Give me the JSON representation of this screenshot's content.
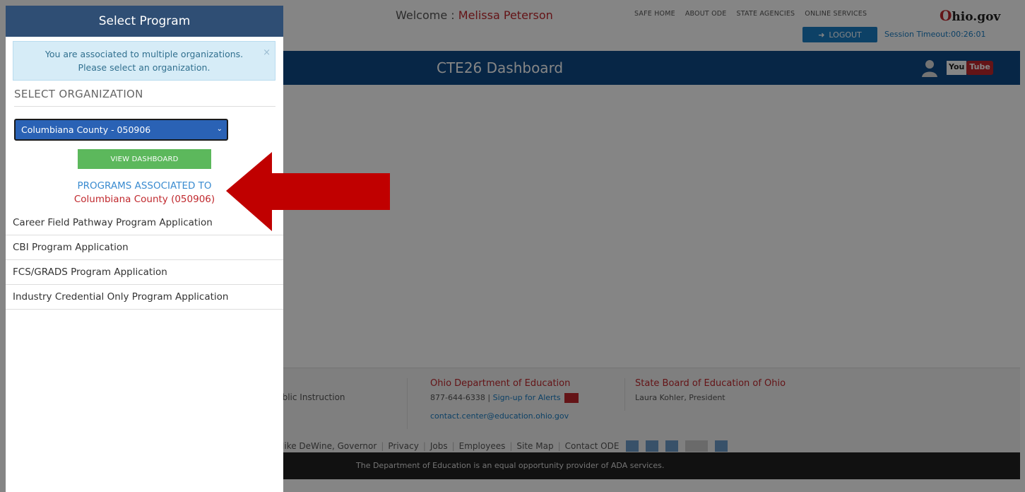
{
  "header": {
    "welcome_prefix": "Welcome :",
    "user_name": "Melissa Peterson",
    "links": [
      "SAFE HOME",
      "ABOUT ODE",
      "STATE AGENCIES",
      "ONLINE SERVICES"
    ],
    "logo_o": "O",
    "logo_rest": "hio.gov",
    "logout_label": "LOGOUT",
    "session_timeout": "Session Timeout:00:26:01"
  },
  "navbar": {
    "title": "CTE26 Dashboard",
    "youtube_you": "You",
    "youtube_tube": "Tube"
  },
  "panel": {
    "title": "Select Program",
    "alert_line1": "You are associated to multiple organizations.",
    "alert_line2": "Please select an organization.",
    "alert_close": "×",
    "select_label": "SELECT ORGANIZATION",
    "selected_org": "Columbiana County - 050906",
    "view_button": "VIEW DASHBOARD",
    "programs_heading": "PROGRAMS ASSOCIATED TO",
    "programs_org": "Columbiana County (050906)",
    "programs": [
      "Career Field Pathway Program Application",
      "CBI Program Application",
      "FCS/GRADS Program Application",
      "Industry Credential Only Program Application"
    ]
  },
  "footer": {
    "col1_text": "ublic Instruction",
    "ode_title": "Ohio Department of Education",
    "phone": "877-644-6338",
    "alerts_link": "Sign-up for Alerts",
    "email": "contact.center@education.ohio.gov",
    "board_title": "State Board of Education of Ohio",
    "board_president": "Laura Kohler, President",
    "bottom_links": [
      "Mike DeWine, Governor",
      "Privacy",
      "Jobs",
      "Employees",
      "Site Map",
      "Contact ODE"
    ],
    "ada_notice": "The Department of Education is an equal opportunity provider of ADA services."
  },
  "colors": {
    "panel_header": "#2f4e74",
    "navbar": "#0f4a86",
    "select_bg": "#2a62b5",
    "view_button": "#5cb85c",
    "arrow": "#c00000",
    "accent_red": "#c0282d"
  }
}
